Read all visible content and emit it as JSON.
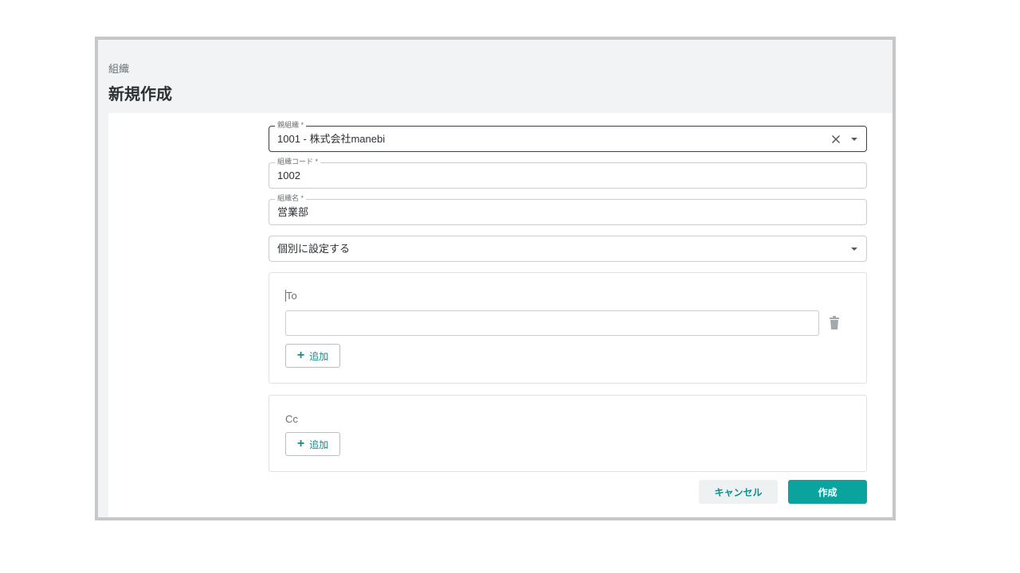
{
  "header": {
    "breadcrumb": "組織",
    "title": "新規作成"
  },
  "form": {
    "parent_org": {
      "label": "親組織 *",
      "value": "1001 - 株式会社manebi"
    },
    "org_code": {
      "label": "組織コード *",
      "value": "1002"
    },
    "org_name": {
      "label": "組織名 *",
      "value": "営業部"
    },
    "notification_setting": {
      "value": "個別に設定する"
    }
  },
  "to_panel": {
    "label": "To",
    "email_value": "",
    "add_label": "追加"
  },
  "cc_panel": {
    "label": "Cc",
    "add_label": "追加"
  },
  "actions": {
    "cancel_label": "キャンセル",
    "create_label": "作成"
  },
  "icons": {
    "clear": "close-icon",
    "dropdown": "caret-down-icon",
    "delete": "trash-icon",
    "add": "plus-icon"
  },
  "colors": {
    "accent": "#0aa39e",
    "accent_text": "#0d8f8c",
    "header_bg": "#f1f3f4"
  }
}
